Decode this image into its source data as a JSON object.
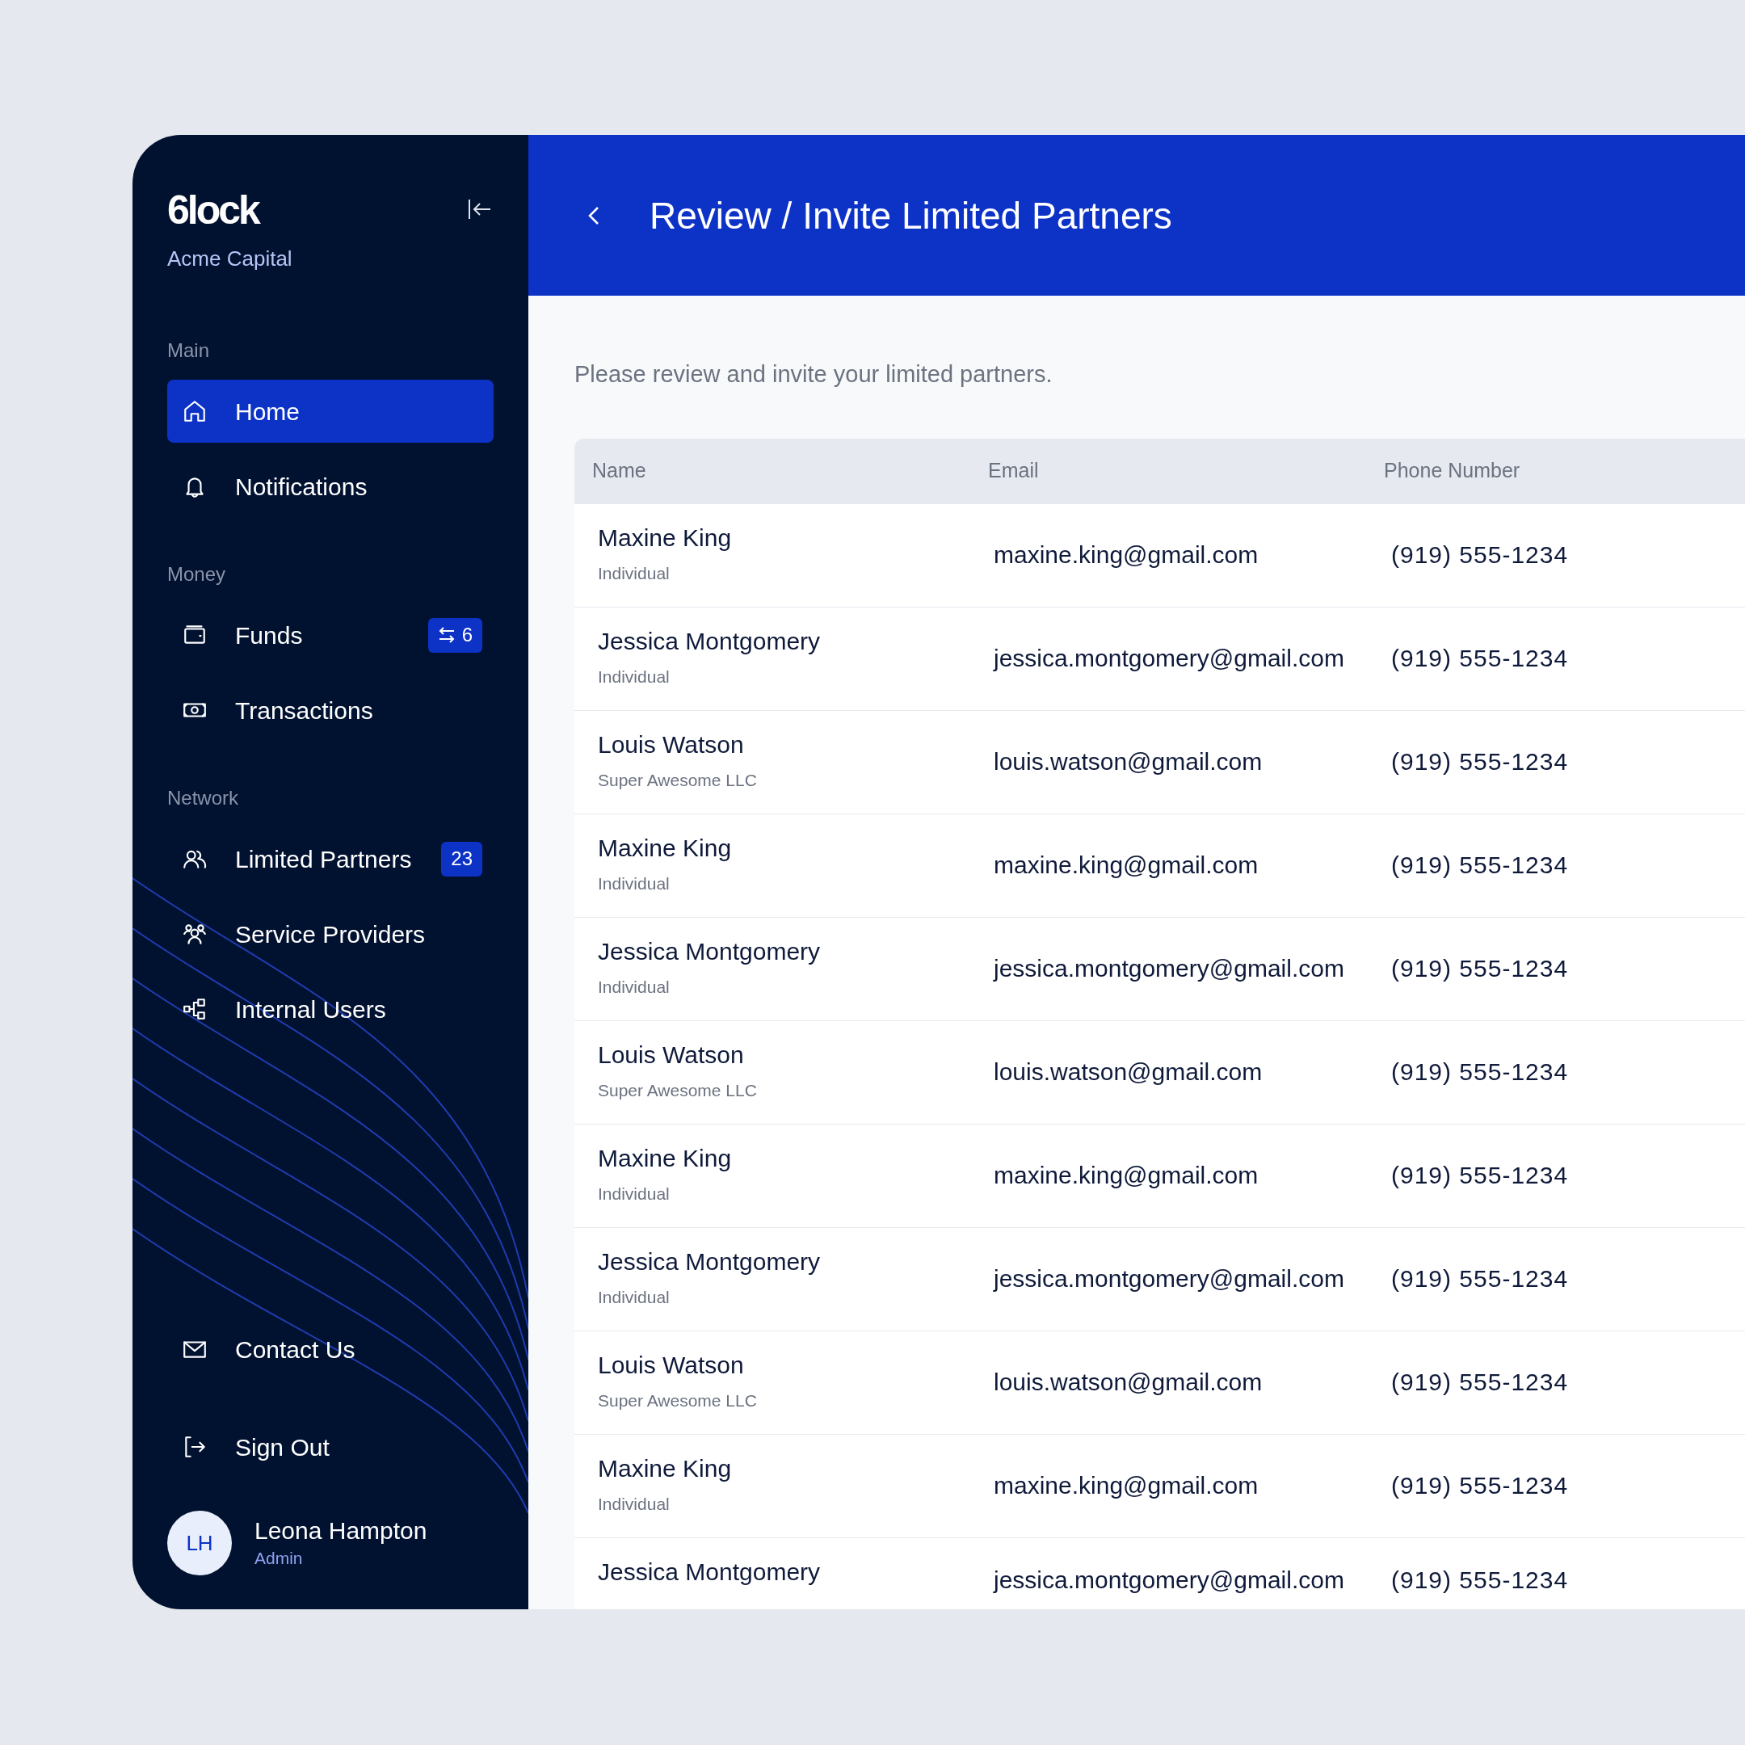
{
  "sidebar": {
    "logo": "6lock",
    "organization": "Acme Capital",
    "sections": [
      {
        "label": "Main",
        "items": [
          {
            "label": "Home",
            "selected": true
          },
          {
            "label": "Notifications",
            "selected": false
          }
        ]
      },
      {
        "label": "Money",
        "items": [
          {
            "label": "Funds",
            "selected": false,
            "badge": {
              "kind": "transfer",
              "text": "6"
            }
          },
          {
            "label": "Transactions",
            "selected": false
          }
        ]
      },
      {
        "label": "Network",
        "items": [
          {
            "label": "Limited Partners",
            "selected": false,
            "badge": {
              "kind": "count",
              "text": "23"
            }
          },
          {
            "label": "Service Providers",
            "selected": false
          },
          {
            "label": "Internal Users",
            "selected": false
          }
        ]
      }
    ],
    "footer_items": [
      {
        "label": "Contact Us"
      },
      {
        "label": "Sign Out"
      }
    ],
    "user": {
      "initials": "LH",
      "name": "Leona Hampton",
      "role": "Admin"
    }
  },
  "header": {
    "title": "Review / Invite Limited Partners"
  },
  "intro": "Please review and invite your limited partners.",
  "table": {
    "columns": [
      "Name",
      "Email",
      "Phone Number"
    ],
    "rows": [
      {
        "name": "Maxine King",
        "type": "Individual",
        "email": "maxine.king@gmail.com",
        "phone": "(919) 555-1234"
      },
      {
        "name": "Jessica Montgomery",
        "type": "Individual",
        "email": "jessica.montgomery@gmail.com",
        "phone": "(919) 555-1234"
      },
      {
        "name": "Louis Watson",
        "type": "Super Awesome LLC",
        "email": "louis.watson@gmail.com",
        "phone": "(919) 555-1234"
      },
      {
        "name": "Maxine King",
        "type": "Individual",
        "email": "maxine.king@gmail.com",
        "phone": "(919) 555-1234"
      },
      {
        "name": "Jessica Montgomery",
        "type": "Individual",
        "email": "jessica.montgomery@gmail.com",
        "phone": "(919) 555-1234"
      },
      {
        "name": "Louis Watson",
        "type": "Super Awesome LLC",
        "email": "louis.watson@gmail.com",
        "phone": "(919) 555-1234"
      },
      {
        "name": "Maxine King",
        "type": "Individual",
        "email": "maxine.king@gmail.com",
        "phone": "(919) 555-1234"
      },
      {
        "name": "Jessica Montgomery",
        "type": "Individual",
        "email": "jessica.montgomery@gmail.com",
        "phone": "(919) 555-1234"
      },
      {
        "name": "Louis Watson",
        "type": "Super Awesome LLC",
        "email": "louis.watson@gmail.com",
        "phone": "(919) 555-1234"
      },
      {
        "name": "Maxine King",
        "type": "Individual",
        "email": "maxine.king@gmail.com",
        "phone": "(919) 555-1234"
      },
      {
        "name": "Jessica Montgomery",
        "email": "jessica.montgomery@gmail.com",
        "phone": "(919) 555-1234"
      }
    ]
  }
}
